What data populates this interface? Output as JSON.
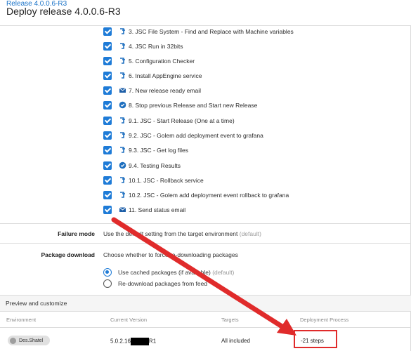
{
  "header": {
    "breadcrumb": "Release 4.0.0.6-R3",
    "title": "Deploy release 4.0.0.6-R3"
  },
  "steps": [
    {
      "label": "3. JSC File System - Find and Replace with Machine variables",
      "icon": "script-icon",
      "checked": true
    },
    {
      "label": "4. JSC Run in 32bits",
      "icon": "script-icon",
      "checked": true
    },
    {
      "label": "5. Configuration Checker",
      "icon": "script-icon",
      "checked": true
    },
    {
      "label": "6. Install AppEngine service",
      "icon": "script-icon",
      "checked": true
    },
    {
      "label": "7. New release ready email",
      "icon": "email-icon",
      "checked": true
    },
    {
      "label": "8. Stop previous Release and Start new Release",
      "icon": "check-circle-icon",
      "checked": true
    },
    {
      "label": "9.1. JSC - Start Release (One at a time)",
      "icon": "script-icon",
      "checked": true
    },
    {
      "label": "9.2. JSC - Golem add deployment event to grafana",
      "icon": "script-icon",
      "checked": true
    },
    {
      "label": "9.3. JSC - Get log files",
      "icon": "script-icon",
      "checked": true
    },
    {
      "label": "9.4. Testing Results",
      "icon": "check-circle-icon",
      "checked": true
    },
    {
      "label": "10.1. JSC - Rollback service",
      "icon": "script-icon",
      "checked": true
    },
    {
      "label": "10.2. JSC - Golem add deployment event rollback to grafana",
      "icon": "script-icon",
      "checked": true
    },
    {
      "label": "11. Send status email",
      "icon": "email-icon",
      "checked": true
    }
  ],
  "failure_mode": {
    "label": "Failure mode",
    "value": "Use the default setting from the target environment",
    "value_suffix": "(default)"
  },
  "package_download": {
    "label": "Package download",
    "description": "Choose whether to force re-downloading packages",
    "options": [
      {
        "label": "Use cached packages (if available)",
        "suffix": "(default)",
        "selected": true
      },
      {
        "label": "Re-download packages from feed",
        "suffix": "",
        "selected": false
      }
    ]
  },
  "preview": {
    "section_title": "Preview and customize",
    "columns": [
      "Environment",
      "Current Version",
      "Targets",
      "Deployment Process"
    ],
    "row": {
      "environment": "Des.Shatel",
      "version_prefix": "5.0.2.16",
      "version_suffix": "R1",
      "targets": "All included",
      "process": "-21 steps"
    }
  },
  "colors": {
    "accent": "#1e7bd7",
    "annotation": "#e02b2b"
  }
}
